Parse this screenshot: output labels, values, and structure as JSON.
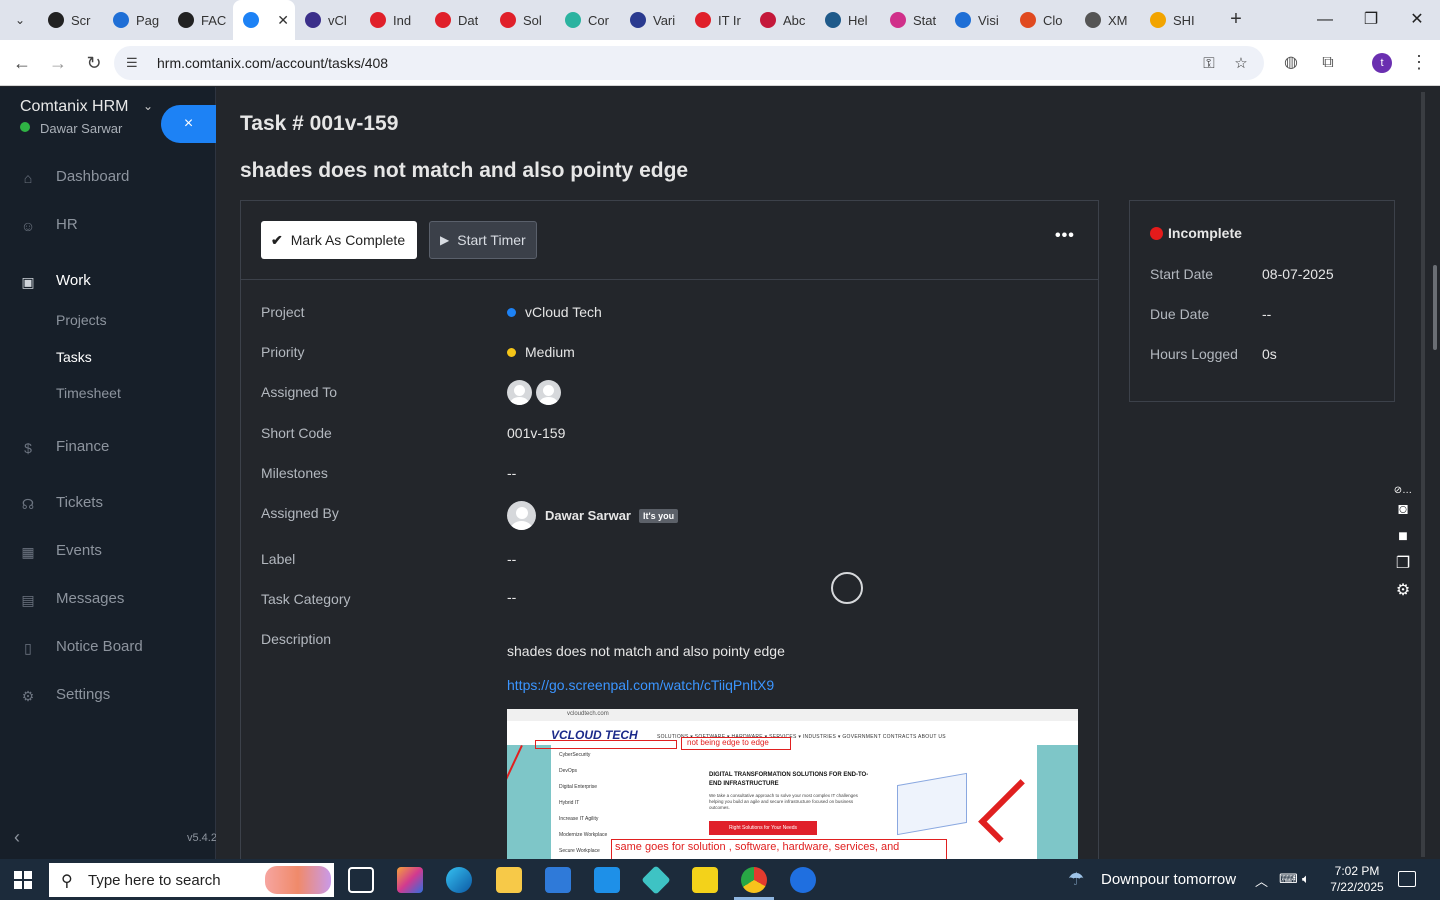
{
  "browser": {
    "tabs": [
      {
        "label": "Scr",
        "color": "#222222"
      },
      {
        "label": "Pag",
        "color": "#1f6fd6"
      },
      {
        "label": "FAC",
        "color": "#222222"
      },
      {
        "label": "",
        "color": "#1d82f5",
        "active": true
      },
      {
        "label": "vCl",
        "color": "#3b2f8a"
      },
      {
        "label": "Ind",
        "color": "#e0202a"
      },
      {
        "label": "Dat",
        "color": "#e0202a"
      },
      {
        "label": "Sol",
        "color": "#e0202a"
      },
      {
        "label": "Cor",
        "color": "#2bb3a0"
      },
      {
        "label": "Vari",
        "color": "#2a3a8f"
      },
      {
        "label": "IT Ir",
        "color": "#e0202a"
      },
      {
        "label": "Abc",
        "color": "#c4183a"
      },
      {
        "label": "Hel",
        "color": "#1f5a8a"
      },
      {
        "label": "Stat",
        "color": "#d0308a"
      },
      {
        "label": "Visi",
        "color": "#1f6fd6"
      },
      {
        "label": "Clo",
        "color": "#e04a20"
      },
      {
        "label": "XM",
        "color": "#555555"
      },
      {
        "label": "SHI",
        "color": "#f2a400"
      }
    ],
    "url": "hrm.comtanix.com/account/tasks/408",
    "profile_initial": "t"
  },
  "sidebar": {
    "brand": "Comtanix HRM",
    "user": "Dawar Sarwar",
    "close_label": "×",
    "items": [
      {
        "label": "Dashboard",
        "icon": "⌂"
      },
      {
        "label": "HR",
        "icon": "☺"
      },
      {
        "label": "Work",
        "icon": "▣"
      },
      {
        "label": "Finance",
        "icon": "$"
      },
      {
        "label": "Tickets",
        "icon": "☊"
      },
      {
        "label": "Events",
        "icon": "▦"
      },
      {
        "label": "Messages",
        "icon": "▤"
      },
      {
        "label": "Notice Board",
        "icon": "▯"
      },
      {
        "label": "Settings",
        "icon": "⚙"
      }
    ],
    "sub_items": [
      "Projects",
      "Tasks",
      "Timesheet"
    ],
    "version": "v5.4.2"
  },
  "task": {
    "number": "Task # 001v-159",
    "title": "shades does not match and also pointy edge",
    "mark_complete": "Mark As Complete",
    "start_timer": "Start Timer",
    "fields": {
      "project_label": "Project",
      "project": "vCloud Tech",
      "project_color": "#1d82f5",
      "priority_label": "Priority",
      "priority": "Medium",
      "priority_color": "#f5c518",
      "assigned_to_label": "Assigned To",
      "short_code_label": "Short Code",
      "short_code": "001v-159",
      "milestones_label": "Milestones",
      "milestones": "--",
      "assigned_by_label": "Assigned By",
      "assigned_by": "Dawar Sarwar",
      "its_you": "It's you",
      "label_label": "Label",
      "label": "--",
      "category_label": "Task Category",
      "category": "--",
      "description_label": "Description",
      "description": "shades does not match and also pointy edge",
      "link": "https://go.screenpal.com/watch/cTiiqPnltX9"
    },
    "attachment": {
      "site_url": "vcloudtech.com",
      "logo": "VCLOUD TECH",
      "nav": "SOLUTIONS ▾   SOFTWARE ▾   HARDWARE ▾   SERVICES ▾   INDUSTRIES ▾   GOVERNMENT CONTRACTS   ABOUT US",
      "note_top": "not being edge to edge",
      "note_bottom": "same goes for solution , software, hardware, services, and",
      "menu": [
        "CyberSecurity",
        "DevOps",
        "Digital Enterprise",
        "Hybrid IT",
        "Increase IT Agility",
        "Modernize Workplace",
        "Secure Workplace"
      ],
      "heading": "DIGITAL TRANSFORMATION SOLUTIONS FOR END-TO-END INFRASTRUCTURE",
      "paragraph": "We take a consultative approach to solve your most complex IT challenges helping you build an agile and secure infrastructure focused on business outcomes.",
      "button": "Right Solutions for Your Needs"
    }
  },
  "status_panel": {
    "status": "Incomplete",
    "start_date_label": "Start Date",
    "start_date": "08-07-2025",
    "due_date_label": "Due Date",
    "due_date": "--",
    "hours_label": "Hours Logged",
    "hours": "0s"
  },
  "taskbar": {
    "search_placeholder": "Type here to search",
    "weather": "Downpour tomorrow",
    "time": "7:02 PM",
    "date": "7/22/2025"
  }
}
